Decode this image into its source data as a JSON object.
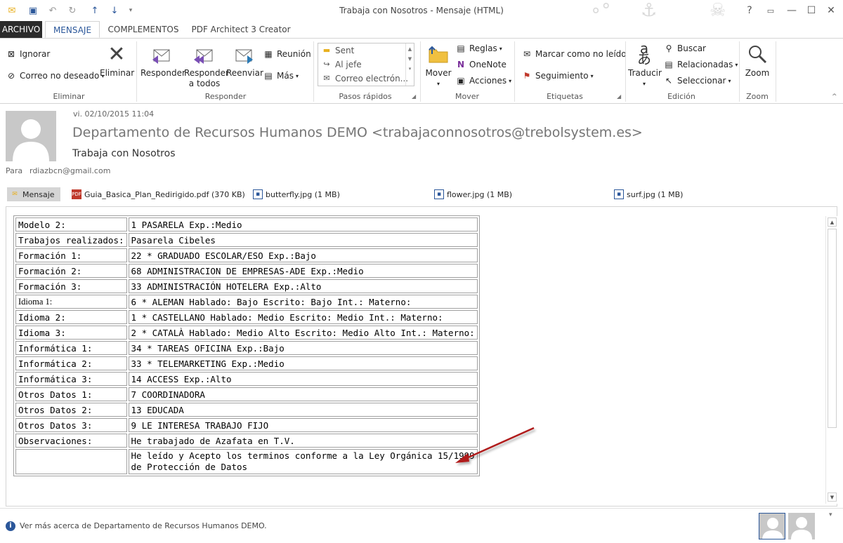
{
  "window": {
    "title": "Trabaja con Nosotros - Mensaje (HTML)"
  },
  "tabs": [
    {
      "label": "ARCHIVO"
    },
    {
      "label": "MENSAJE"
    },
    {
      "label": "COMPLEMENTOS"
    },
    {
      "label": "PDF Architect 3 Creator"
    }
  ],
  "ribbon": {
    "eliminar": {
      "ignorar": "Ignorar",
      "junk": "Correo no deseado",
      "delete": "Eliminar",
      "label": "Eliminar"
    },
    "responder": {
      "reply": "Responder",
      "reply_all_1": "Responder",
      "reply_all_2": "a todos",
      "forward": "Reenviar",
      "meeting": "Reunión",
      "more": "Más",
      "label": "Responder"
    },
    "pasos": {
      "items": [
        "Sent",
        "Al jefe",
        "Correo electrón..."
      ],
      "label": "Pasos rápidos"
    },
    "mover": {
      "move": "Mover",
      "rules": "Reglas",
      "onenote": "OneNote",
      "actions": "Acciones",
      "label": "Mover"
    },
    "etiquetas": {
      "unread": "Marcar como no leído",
      "followup": "Seguimiento",
      "label": "Etiquetas"
    },
    "edicion": {
      "translate": "Traducir",
      "find": "Buscar",
      "related": "Relacionadas",
      "select": "Seleccionar",
      "label": "Edición"
    },
    "zoom": {
      "zoom": "Zoom",
      "label": "Zoom"
    }
  },
  "header": {
    "date": "vi. 02/10/2015 11:04",
    "from": "Departamento de Recursos Humanos DEMO <trabajaconnosotros@trebolsystem.es>",
    "subject": "Trabaja con Nosotros",
    "to_label": "Para",
    "to_value": "rdiazbcn@gmail.com"
  },
  "attachments": [
    {
      "name": "Mensaje"
    },
    {
      "name": "Guia_Basica_Plan_Redirigido.pdf (370 KB)"
    },
    {
      "name": "butterfly.jpg (1 MB)"
    },
    {
      "name": "flower.jpg (1 MB)"
    },
    {
      "name": "surf.jpg (1 MB)"
    }
  ],
  "rows": [
    {
      "k": "Modelo 2:",
      "v": "1 PASARELA Exp.:Medio"
    },
    {
      "k": "Trabajos realizados:",
      "v": "Pasarela Cibeles"
    },
    {
      "k": "Formación 1:",
      "v": "22 * GRADUADO ESCOLAR/ESO Exp.:Bajo"
    },
    {
      "k": "Formación 2:",
      "v": "68 ADMINISTRACION DE EMPRESAS-ADE Exp.:Medio"
    },
    {
      "k": "Formación 3:",
      "v": "33 ADMINISTRACIÓN HOTELERA Exp.:Alto"
    },
    {
      "k": "Idioma 1:",
      "v": "6 * ALEMAN Hablado: Bajo Escrito: Bajo Int.: Materno:"
    },
    {
      "k": "Idioma 2:",
      "v": "1 * CASTELLANO Hablado: Medio Escrito: Medio Int.: Materno:"
    },
    {
      "k": "Idioma 3:",
      "v": "2 * CATALÀ Hablado: Medio Alto Escrito: Medio Alto Int.: Materno:"
    },
    {
      "k": "Informática 1:",
      "v": "34 * TAREAS OFICINA Exp.:Bajo"
    },
    {
      "k": "Informática 2:",
      "v": "33 * TELEMARKETING Exp.:Medio"
    },
    {
      "k": "Informática 3:",
      "v": "14 ACCESS Exp.:Alto"
    },
    {
      "k": "Otros Datos 1:",
      "v": "7 COORDINADORA"
    },
    {
      "k": "Otros Datos 2:",
      "v": "13 EDUCADA"
    },
    {
      "k": "Otros Datos 3:",
      "v": "9 LE INTERESA TRABAJO FIJO"
    },
    {
      "k": "Observaciones:",
      "v": "He trabajado de Azafata en T.V."
    },
    {
      "k": "",
      "v": "He leído y Acepto los terminos conforme a la Ley Orgánica 15/1999 de Protección de Datos"
    }
  ],
  "footer": {
    "message": "Ver más acerca de Departamento de Recursos Humanos DEMO."
  },
  "colors": {
    "accent": "#2b579a",
    "arrow": "#b01c1c"
  }
}
